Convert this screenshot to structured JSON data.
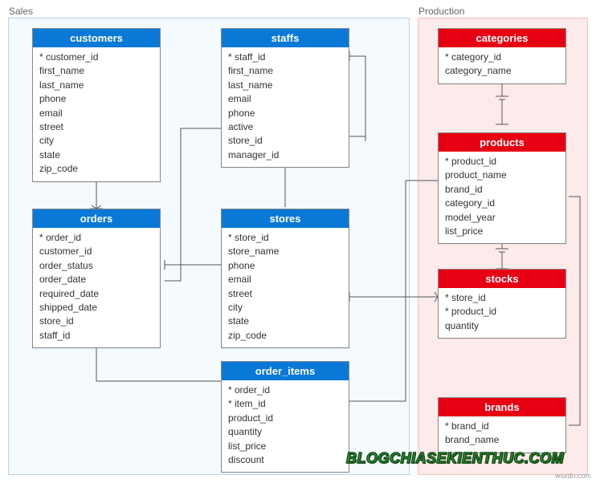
{
  "schemas": {
    "sales": {
      "label": "Sales"
    },
    "production": {
      "label": "Production"
    }
  },
  "tables": {
    "customers": {
      "title": "customers",
      "columns": [
        "* customer_id",
        "first_name",
        "last_name",
        "phone",
        "email",
        "street",
        "city",
        "state",
        "zip_code"
      ]
    },
    "staffs": {
      "title": "staffs",
      "columns": [
        "* staff_id",
        "first_name",
        "last_name",
        "email",
        "phone",
        "active",
        "store_id",
        "manager_id"
      ]
    },
    "orders": {
      "title": "orders",
      "columns": [
        "* order_id",
        "customer_id",
        "order_status",
        "order_date",
        "required_date",
        "shipped_date",
        "store_id",
        "staff_id"
      ]
    },
    "stores": {
      "title": "stores",
      "columns": [
        "* store_id",
        "store_name",
        "phone",
        "email",
        "street",
        "city",
        "state",
        "zip_code"
      ]
    },
    "order_items": {
      "title": "order_items",
      "columns": [
        "* order_id",
        "* item_id",
        "product_id",
        "quantity",
        "list_price",
        "discount"
      ]
    },
    "categories": {
      "title": "categories",
      "columns": [
        "* category_id",
        "category_name"
      ]
    },
    "products": {
      "title": "products",
      "columns": [
        "* product_id",
        "product_name",
        "brand_id",
        "category_id",
        "model_year",
        "list_price"
      ]
    },
    "stocks": {
      "title": "stocks",
      "columns": [
        "* store_id",
        "* product_id",
        "quantity"
      ]
    },
    "brands": {
      "title": "brands",
      "columns": [
        "* brand_id",
        "brand_name"
      ]
    }
  },
  "watermark": "BLOGCHIASEKIENTHUC.COM",
  "corner": "wsxdn.com",
  "relationships": [
    {
      "from": "customers",
      "to": "orders"
    },
    {
      "from": "staffs",
      "to": "orders"
    },
    {
      "from": "staffs",
      "to": "staffs",
      "self": true
    },
    {
      "from": "stores",
      "to": "staffs"
    },
    {
      "from": "stores",
      "to": "orders"
    },
    {
      "from": "orders",
      "to": "order_items"
    },
    {
      "from": "products",
      "to": "order_items"
    },
    {
      "from": "categories",
      "to": "products"
    },
    {
      "from": "products",
      "to": "stocks"
    },
    {
      "from": "stores",
      "to": "stocks"
    },
    {
      "from": "brands",
      "to": "products"
    }
  ]
}
